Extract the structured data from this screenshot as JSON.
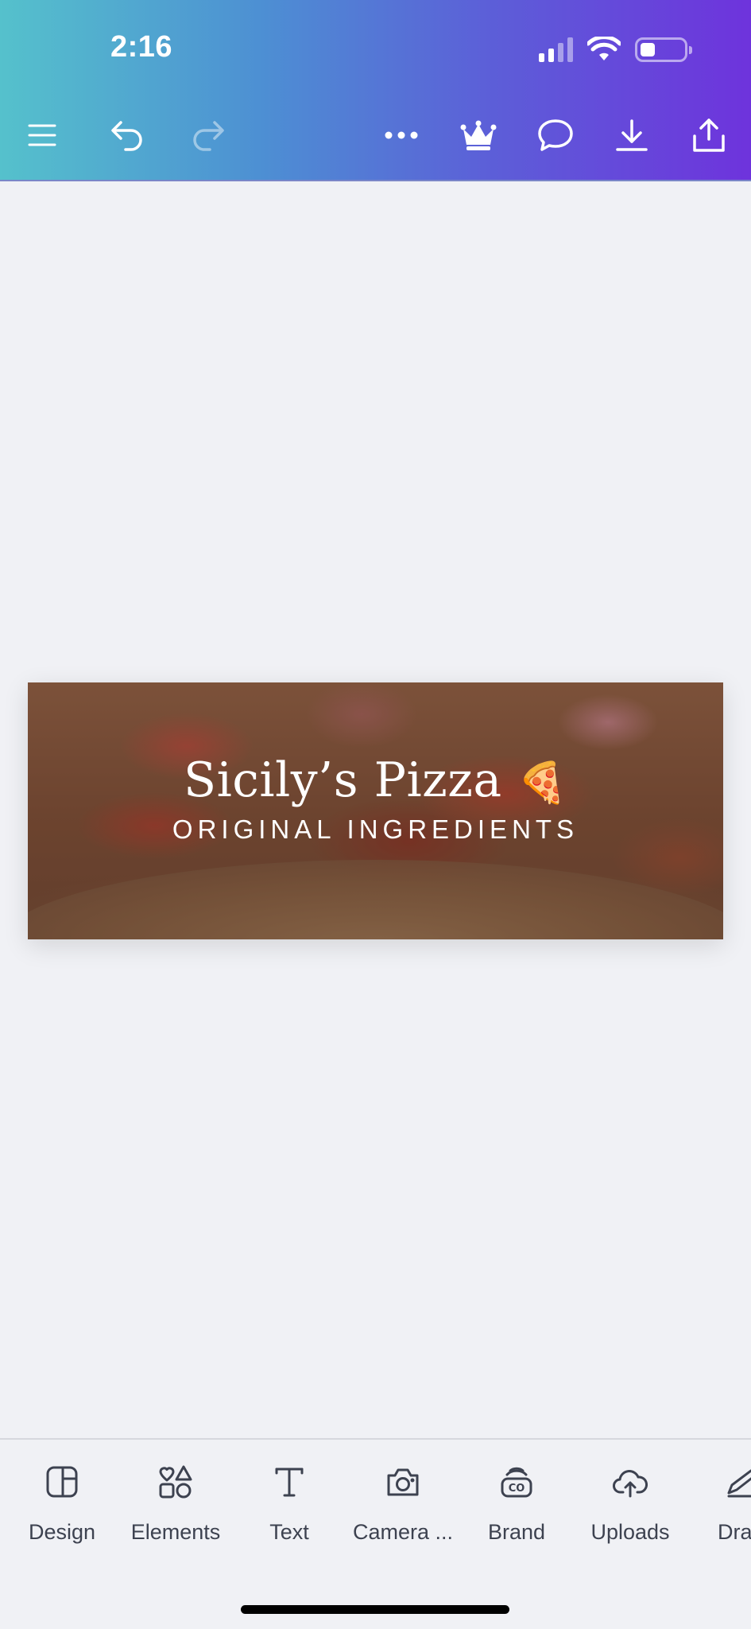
{
  "status_bar": {
    "time": "2:16",
    "signal_bars": 2,
    "battery_level": 0.25
  },
  "toolbar": {
    "icons": [
      "menu-icon",
      "undo-icon",
      "redo-icon",
      "more-icon",
      "crown-icon",
      "comment-icon",
      "download-icon",
      "share-icon"
    ]
  },
  "design": {
    "title": "Sicily’s Pizza",
    "emoji": "🍕",
    "subtitle": "ORIGINAL INGREDIENTS"
  },
  "bottom_toolbar": {
    "items": [
      {
        "label": "Design",
        "icon": "design-icon"
      },
      {
        "label": "Elements",
        "icon": "elements-icon"
      },
      {
        "label": "Text",
        "icon": "text-icon"
      },
      {
        "label": "Camera ...",
        "icon": "camera-icon"
      },
      {
        "label": "Brand",
        "icon": "brand-icon"
      },
      {
        "label": "Uploads",
        "icon": "uploads-icon"
      },
      {
        "label": "Dra",
        "icon": "draw-icon"
      }
    ]
  },
  "colors": {
    "header_gradient_start": "#55c1cc",
    "header_gradient_end": "#6e33dc",
    "background": "#f0f1f5",
    "label_text": "#3d4250"
  }
}
